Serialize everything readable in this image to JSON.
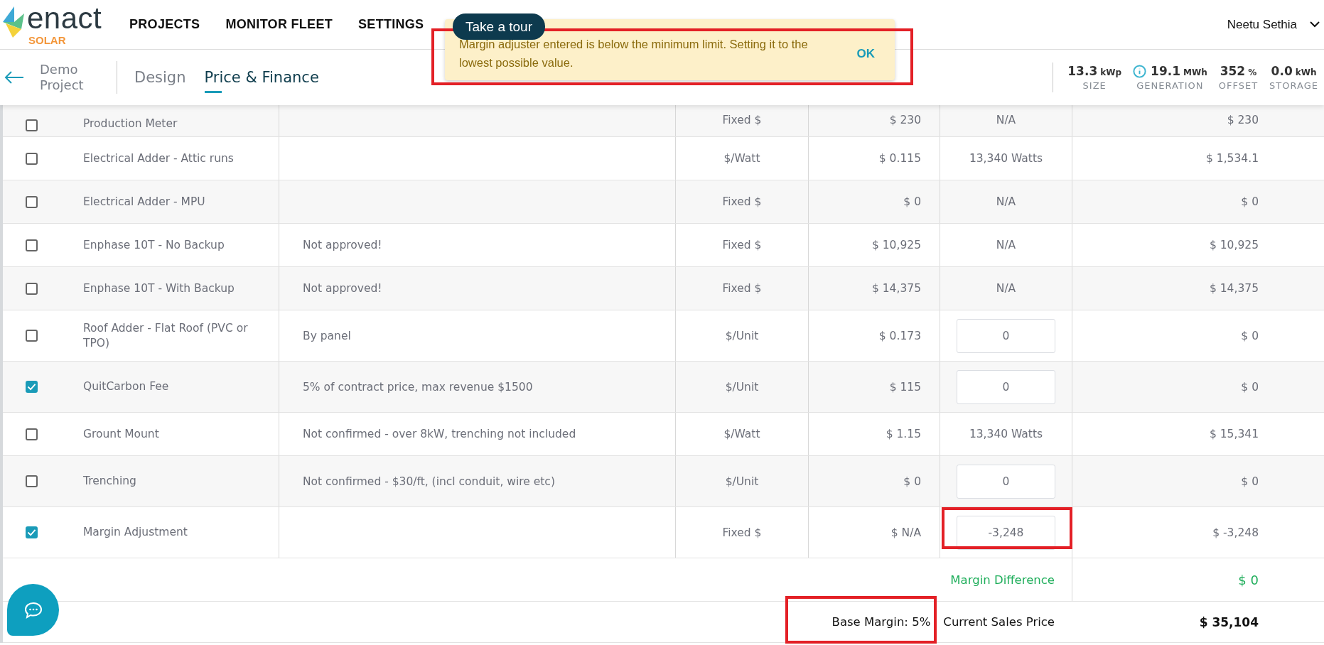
{
  "brand": {
    "name": "enact",
    "tagline": "SOLAR"
  },
  "nav": [
    {
      "label": "PROJECTS"
    },
    {
      "label": "MONITOR FLEET"
    },
    {
      "label": "SETTINGS"
    }
  ],
  "tour_button": "Take a tour",
  "user": {
    "name": "Neetu Sethia"
  },
  "toast": {
    "message": "Margin adjuster entered is below the minimum limit. Setting it to the lowest possible value.",
    "action": "OK"
  },
  "project": {
    "name": "Demo Project"
  },
  "tabs": [
    {
      "label": "Design",
      "selected": false
    },
    {
      "label": "Price & Finance",
      "selected": true
    }
  ],
  "stats": [
    {
      "value": "13.3",
      "unit": "kWp",
      "label": "SIZE",
      "info": false
    },
    {
      "value": "19.1",
      "unit": "MWh",
      "label": "GENERATION",
      "info": true
    },
    {
      "value": "352",
      "unit": "%",
      "label": "OFFSET",
      "info": false
    },
    {
      "value": "0.0",
      "unit": "kWh",
      "label": "STORAGE",
      "info": false
    }
  ],
  "rows": [
    {
      "checked": false,
      "name": "Production Meter",
      "description": "",
      "unit": "Fixed $",
      "price": "$ 230",
      "quantity": {
        "kind": "text",
        "value": "N/A"
      },
      "total": "$ 230"
    },
    {
      "checked": false,
      "name": "Electrical Adder - Attic runs",
      "description": "",
      "unit": "$/Watt",
      "price": "$ 0.115",
      "quantity": {
        "kind": "text",
        "value": "13,340 Watts"
      },
      "total": "$ 1,534.1"
    },
    {
      "checked": false,
      "name": "Electrical Adder - MPU",
      "description": "",
      "unit": "Fixed $",
      "price": "$ 0",
      "quantity": {
        "kind": "text",
        "value": "N/A"
      },
      "total": "$ 0"
    },
    {
      "checked": false,
      "name": "Enphase 10T - No Backup",
      "description": "Not approved!",
      "unit": "Fixed $",
      "price": "$ 10,925",
      "quantity": {
        "kind": "text",
        "value": "N/A"
      },
      "total": "$ 10,925"
    },
    {
      "checked": false,
      "name": "Enphase 10T - With Backup",
      "description": "Not approved!",
      "unit": "Fixed $",
      "price": "$ 14,375",
      "quantity": {
        "kind": "text",
        "value": "N/A"
      },
      "total": "$ 14,375"
    },
    {
      "checked": false,
      "name": "Roof Adder - Flat Roof (PVC or TPO)",
      "description": "By panel",
      "unit": "$/Unit",
      "price": "$ 0.173",
      "quantity": {
        "kind": "input",
        "value": "0"
      },
      "total": "$ 0"
    },
    {
      "checked": true,
      "name": "QuitCarbon Fee",
      "description": "5% of contract price, max revenue $1500",
      "unit": "$/Unit",
      "price": "$ 115",
      "quantity": {
        "kind": "input",
        "value": "0"
      },
      "total": "$ 0"
    },
    {
      "checked": false,
      "name": "Grount Mount",
      "description": "Not confirmed - over 8kW, trenching not included",
      "unit": "$/Watt",
      "price": "$ 1.15",
      "quantity": {
        "kind": "text",
        "value": "13,340 Watts"
      },
      "total": "$ 15,341"
    },
    {
      "checked": false,
      "name": "Trenching",
      "description": "Not confirmed - $30/ft, (incl conduit, wire etc)",
      "unit": "$/Unit",
      "price": "$ 0",
      "quantity": {
        "kind": "input",
        "value": "0"
      },
      "total": "$ 0"
    },
    {
      "checked": true,
      "name": "Margin Adjustment",
      "description": "",
      "unit": "Fixed $",
      "price": "$ N/A",
      "quantity": {
        "kind": "input",
        "value": "-3,248"
      },
      "total": "$ -3,248"
    }
  ],
  "margin_difference": {
    "label": "Margin Difference",
    "value": "$ 0"
  },
  "base_margin": "Base Margin: 5%",
  "sales_price": {
    "label": "Current Sales Price",
    "value": "$ 35,104"
  }
}
